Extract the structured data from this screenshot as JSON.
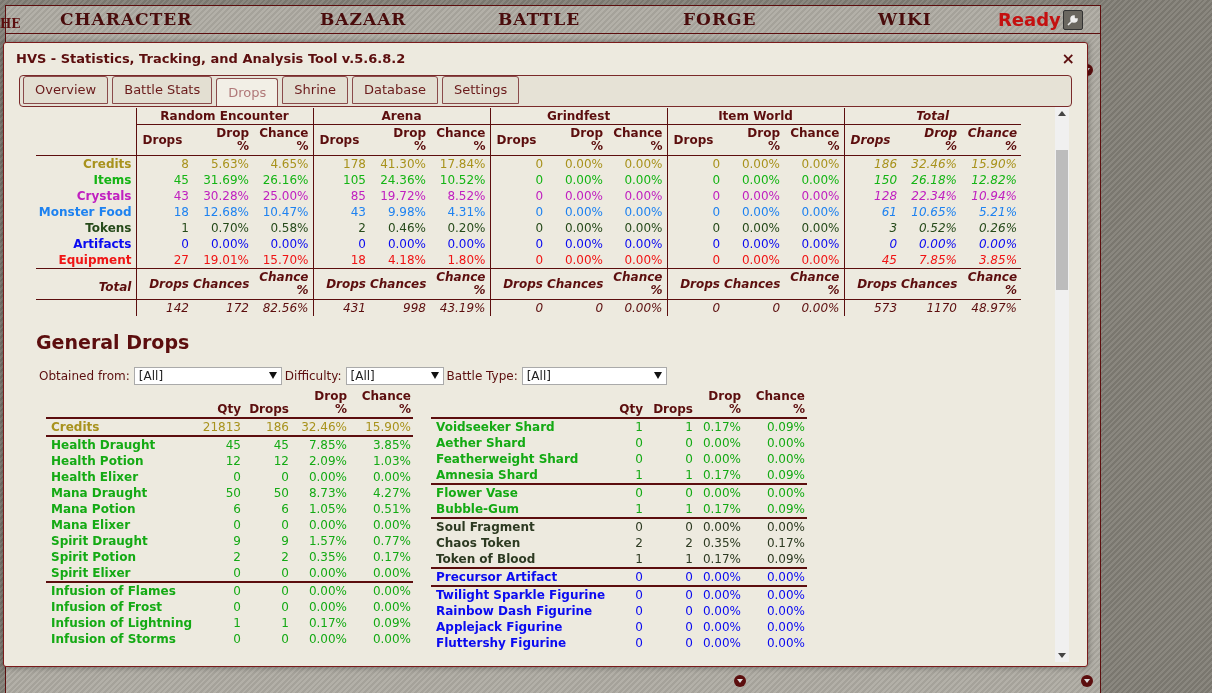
{
  "nav": {
    "cut_text": "HE",
    "items": [
      {
        "label": "CHARACTER"
      },
      {
        "label": "BAZAAR"
      },
      {
        "label": "BATTLE"
      },
      {
        "label": "FORGE"
      },
      {
        "label": "WIKI"
      }
    ],
    "status": "Ready"
  },
  "window": {
    "title": "HVS - Statistics, Tracking, and Analysis Tool v.5.6.8.2",
    "close": "×"
  },
  "tabs": [
    {
      "label": "Overview",
      "selected": false
    },
    {
      "label": "Battle Stats",
      "selected": false
    },
    {
      "label": "Drops",
      "selected": true
    },
    {
      "label": "Shrine",
      "selected": false
    },
    {
      "label": "Database",
      "selected": false
    },
    {
      "label": "Settings",
      "selected": false
    }
  ],
  "summary": {
    "groups": [
      {
        "name": "Random Encounter",
        "kind": "source",
        "columns": [
          "Drops",
          "Drop\n%",
          "Chance\n%"
        ],
        "total_columns": [
          "Drops",
          "Chances",
          "Chance\n%"
        ],
        "totals": [
          "142",
          "172",
          "82.56%"
        ]
      },
      {
        "name": "Arena",
        "kind": "source",
        "columns": [
          "Drops",
          "Drop\n%",
          "Chance\n%"
        ],
        "total_columns": [
          "Drops",
          "Chances",
          "Chance\n%"
        ],
        "totals": [
          "431",
          "998",
          "43.19%"
        ]
      },
      {
        "name": "Grindfest",
        "kind": "source",
        "columns": [
          "Drops",
          "Drop\n%",
          "Chance\n%"
        ],
        "total_columns": [
          "Drops",
          "Chances",
          "Chance\n%"
        ],
        "totals": [
          "0",
          "0",
          "0.00%"
        ]
      },
      {
        "name": "Item World",
        "kind": "source",
        "columns": [
          "Drops",
          "Drop\n%",
          "Chance\n%"
        ],
        "total_columns": [
          "Drops",
          "Chances",
          "Chance\n%"
        ],
        "totals": [
          "0",
          "0",
          "0.00%"
        ]
      },
      {
        "name": "Total",
        "kind": "total",
        "columns": [
          "Drops",
          "Drop\n%",
          "Chance\n%"
        ],
        "total_columns": [
          "Drops",
          "Chances",
          "Chance\n%"
        ],
        "totals": [
          "573",
          "1170",
          "48.97%"
        ]
      }
    ],
    "rows": [
      {
        "label": "Credits",
        "color": "#a8921c",
        "cells": [
          "8",
          "5.63%",
          "4.65%",
          "178",
          "41.30%",
          "17.84%",
          "0",
          "0.00%",
          "0.00%",
          "0",
          "0.00%",
          "0.00%",
          "186",
          "32.46%",
          "15.90%"
        ]
      },
      {
        "label": "Items",
        "color": "#14b414",
        "cells": [
          "45",
          "31.69%",
          "26.16%",
          "105",
          "24.36%",
          "10.52%",
          "0",
          "0.00%",
          "0.00%",
          "0",
          "0.00%",
          "0.00%",
          "150",
          "26.18%",
          "12.82%"
        ]
      },
      {
        "label": "Crystals",
        "color": "#c020c0",
        "cells": [
          "43",
          "30.28%",
          "25.00%",
          "85",
          "19.72%",
          "8.52%",
          "0",
          "0.00%",
          "0.00%",
          "0",
          "0.00%",
          "0.00%",
          "128",
          "22.34%",
          "10.94%"
        ]
      },
      {
        "label": "Monster Food",
        "color": "#1e82f0",
        "cells": [
          "18",
          "12.68%",
          "10.47%",
          "43",
          "9.98%",
          "4.31%",
          "0",
          "0.00%",
          "0.00%",
          "0",
          "0.00%",
          "0.00%",
          "61",
          "10.65%",
          "5.21%"
        ]
      },
      {
        "label": "Tokens",
        "color": "#264a1a",
        "cells": [
          "1",
          "0.70%",
          "0.58%",
          "2",
          "0.46%",
          "0.20%",
          "0",
          "0.00%",
          "0.00%",
          "0",
          "0.00%",
          "0.00%",
          "3",
          "0.52%",
          "0.26%"
        ]
      },
      {
        "label": "Artifacts",
        "color": "#0a0af0",
        "cells": [
          "0",
          "0.00%",
          "0.00%",
          "0",
          "0.00%",
          "0.00%",
          "0",
          "0.00%",
          "0.00%",
          "0",
          "0.00%",
          "0.00%",
          "0",
          "0.00%",
          "0.00%"
        ]
      },
      {
        "label": "Equipment",
        "color": "#f01414",
        "cells": [
          "27",
          "19.01%",
          "15.70%",
          "18",
          "4.18%",
          "1.80%",
          "0",
          "0.00%",
          "0.00%",
          "0",
          "0.00%",
          "0.00%",
          "45",
          "7.85%",
          "3.85%"
        ]
      }
    ],
    "total_label": "Total"
  },
  "general": {
    "title": "General Drops",
    "filters": [
      {
        "label": "Obtained from:",
        "value": "[All]"
      },
      {
        "label": "Difficulty:",
        "value": "[All]"
      },
      {
        "label": "Battle Type:",
        "value": "[All]"
      }
    ],
    "tables": [
      {
        "columns": [
          "Qty",
          "Drops",
          "Drop\n%",
          "Chance\n%"
        ],
        "sections": [
          {
            "rows": [
              {
                "name": "Credits",
                "color": "#a8921c",
                "cells": [
                  "21813",
                  "186",
                  "32.46%",
                  "15.90%"
                ]
              }
            ]
          },
          {
            "rows": [
              {
                "name": "Health Draught",
                "color": "#14aa14",
                "cells": [
                  "45",
                  "45",
                  "7.85%",
                  "3.85%"
                ]
              },
              {
                "name": "Health Potion",
                "color": "#14aa14",
                "cells": [
                  "12",
                  "12",
                  "2.09%",
                  "1.03%"
                ]
              },
              {
                "name": "Health Elixer",
                "color": "#14aa14",
                "cells": [
                  "0",
                  "0",
                  "0.00%",
                  "0.00%"
                ]
              },
              {
                "name": "Mana Draught",
                "color": "#14aa14",
                "cells": [
                  "50",
                  "50",
                  "8.73%",
                  "4.27%"
                ]
              },
              {
                "name": "Mana Potion",
                "color": "#14aa14",
                "cells": [
                  "6",
                  "6",
                  "1.05%",
                  "0.51%"
                ]
              },
              {
                "name": "Mana Elixer",
                "color": "#14aa14",
                "cells": [
                  "0",
                  "0",
                  "0.00%",
                  "0.00%"
                ]
              },
              {
                "name": "Spirit Draught",
                "color": "#14aa14",
                "cells": [
                  "9",
                  "9",
                  "1.57%",
                  "0.77%"
                ]
              },
              {
                "name": "Spirit Potion",
                "color": "#14aa14",
                "cells": [
                  "2",
                  "2",
                  "0.35%",
                  "0.17%"
                ]
              },
              {
                "name": "Spirit Elixer",
                "color": "#14aa14",
                "cells": [
                  "0",
                  "0",
                  "0.00%",
                  "0.00%"
                ]
              }
            ]
          },
          {
            "rows": [
              {
                "name": "Infusion of Flames",
                "color": "#14aa14",
                "cells": [
                  "0",
                  "0",
                  "0.00%",
                  "0.00%"
                ]
              },
              {
                "name": "Infusion of Frost",
                "color": "#14aa14",
                "cells": [
                  "0",
                  "0",
                  "0.00%",
                  "0.00%"
                ]
              },
              {
                "name": "Infusion of Lightning",
                "color": "#14aa14",
                "cells": [
                  "1",
                  "1",
                  "0.17%",
                  "0.09%"
                ]
              },
              {
                "name": "Infusion of Storms",
                "color": "#14aa14",
                "cells": [
                  "0",
                  "0",
                  "0.00%",
                  "0.00%"
                ]
              }
            ]
          }
        ]
      },
      {
        "columns": [
          "Qty",
          "Drops",
          "Drop\n%",
          "Chance\n%"
        ],
        "sections": [
          {
            "rows": [
              {
                "name": "Voidseeker Shard",
                "color": "#14aa14",
                "cells": [
                  "1",
                  "1",
                  "0.17%",
                  "0.09%"
                ]
              },
              {
                "name": "Aether Shard",
                "color": "#14aa14",
                "cells": [
                  "0",
                  "0",
                  "0.00%",
                  "0.00%"
                ]
              },
              {
                "name": "Featherweight Shard",
                "color": "#14aa14",
                "cells": [
                  "0",
                  "0",
                  "0.00%",
                  "0.00%"
                ]
              },
              {
                "name": "Amnesia Shard",
                "color": "#14aa14",
                "cells": [
                  "1",
                  "1",
                  "0.17%",
                  "0.09%"
                ]
              }
            ]
          },
          {
            "rows": [
              {
                "name": "Flower Vase",
                "color": "#14aa14",
                "cells": [
                  "0",
                  "0",
                  "0.00%",
                  "0.00%"
                ]
              },
              {
                "name": "Bubble-Gum",
                "color": "#14aa14",
                "cells": [
                  "1",
                  "1",
                  "0.17%",
                  "0.09%"
                ]
              }
            ]
          },
          {
            "rows": [
              {
                "name": "Soul Fragment",
                "color": "#2d3a22",
                "cells": [
                  "0",
                  "0",
                  "0.00%",
                  "0.00%"
                ]
              },
              {
                "name": "Chaos Token",
                "color": "#2d3a22",
                "cells": [
                  "2",
                  "2",
                  "0.35%",
                  "0.17%"
                ]
              },
              {
                "name": "Token of Blood",
                "color": "#2d3a22",
                "cells": [
                  "1",
                  "1",
                  "0.17%",
                  "0.09%"
                ]
              }
            ]
          },
          {
            "rows": [
              {
                "name": "Precursor Artifact",
                "color": "#0a0af0",
                "cells": [
                  "0",
                  "0",
                  "0.00%",
                  "0.00%"
                ]
              }
            ]
          },
          {
            "rows": [
              {
                "name": "Twilight Sparkle Figurine",
                "color": "#0a0af0",
                "cells": [
                  "0",
                  "0",
                  "0.00%",
                  "0.00%"
                ]
              },
              {
                "name": "Rainbow Dash Figurine",
                "color": "#0a0af0",
                "cells": [
                  "0",
                  "0",
                  "0.00%",
                  "0.00%"
                ]
              },
              {
                "name": "Applejack Figurine",
                "color": "#0a0af0",
                "cells": [
                  "0",
                  "0",
                  "0.00%",
                  "0.00%"
                ]
              },
              {
                "name": "Fluttershy Figurine",
                "color": "#0a0af0",
                "cells": [
                  "0",
                  "0",
                  "0.00%",
                  "0.00%"
                ]
              }
            ]
          }
        ]
      }
    ]
  }
}
